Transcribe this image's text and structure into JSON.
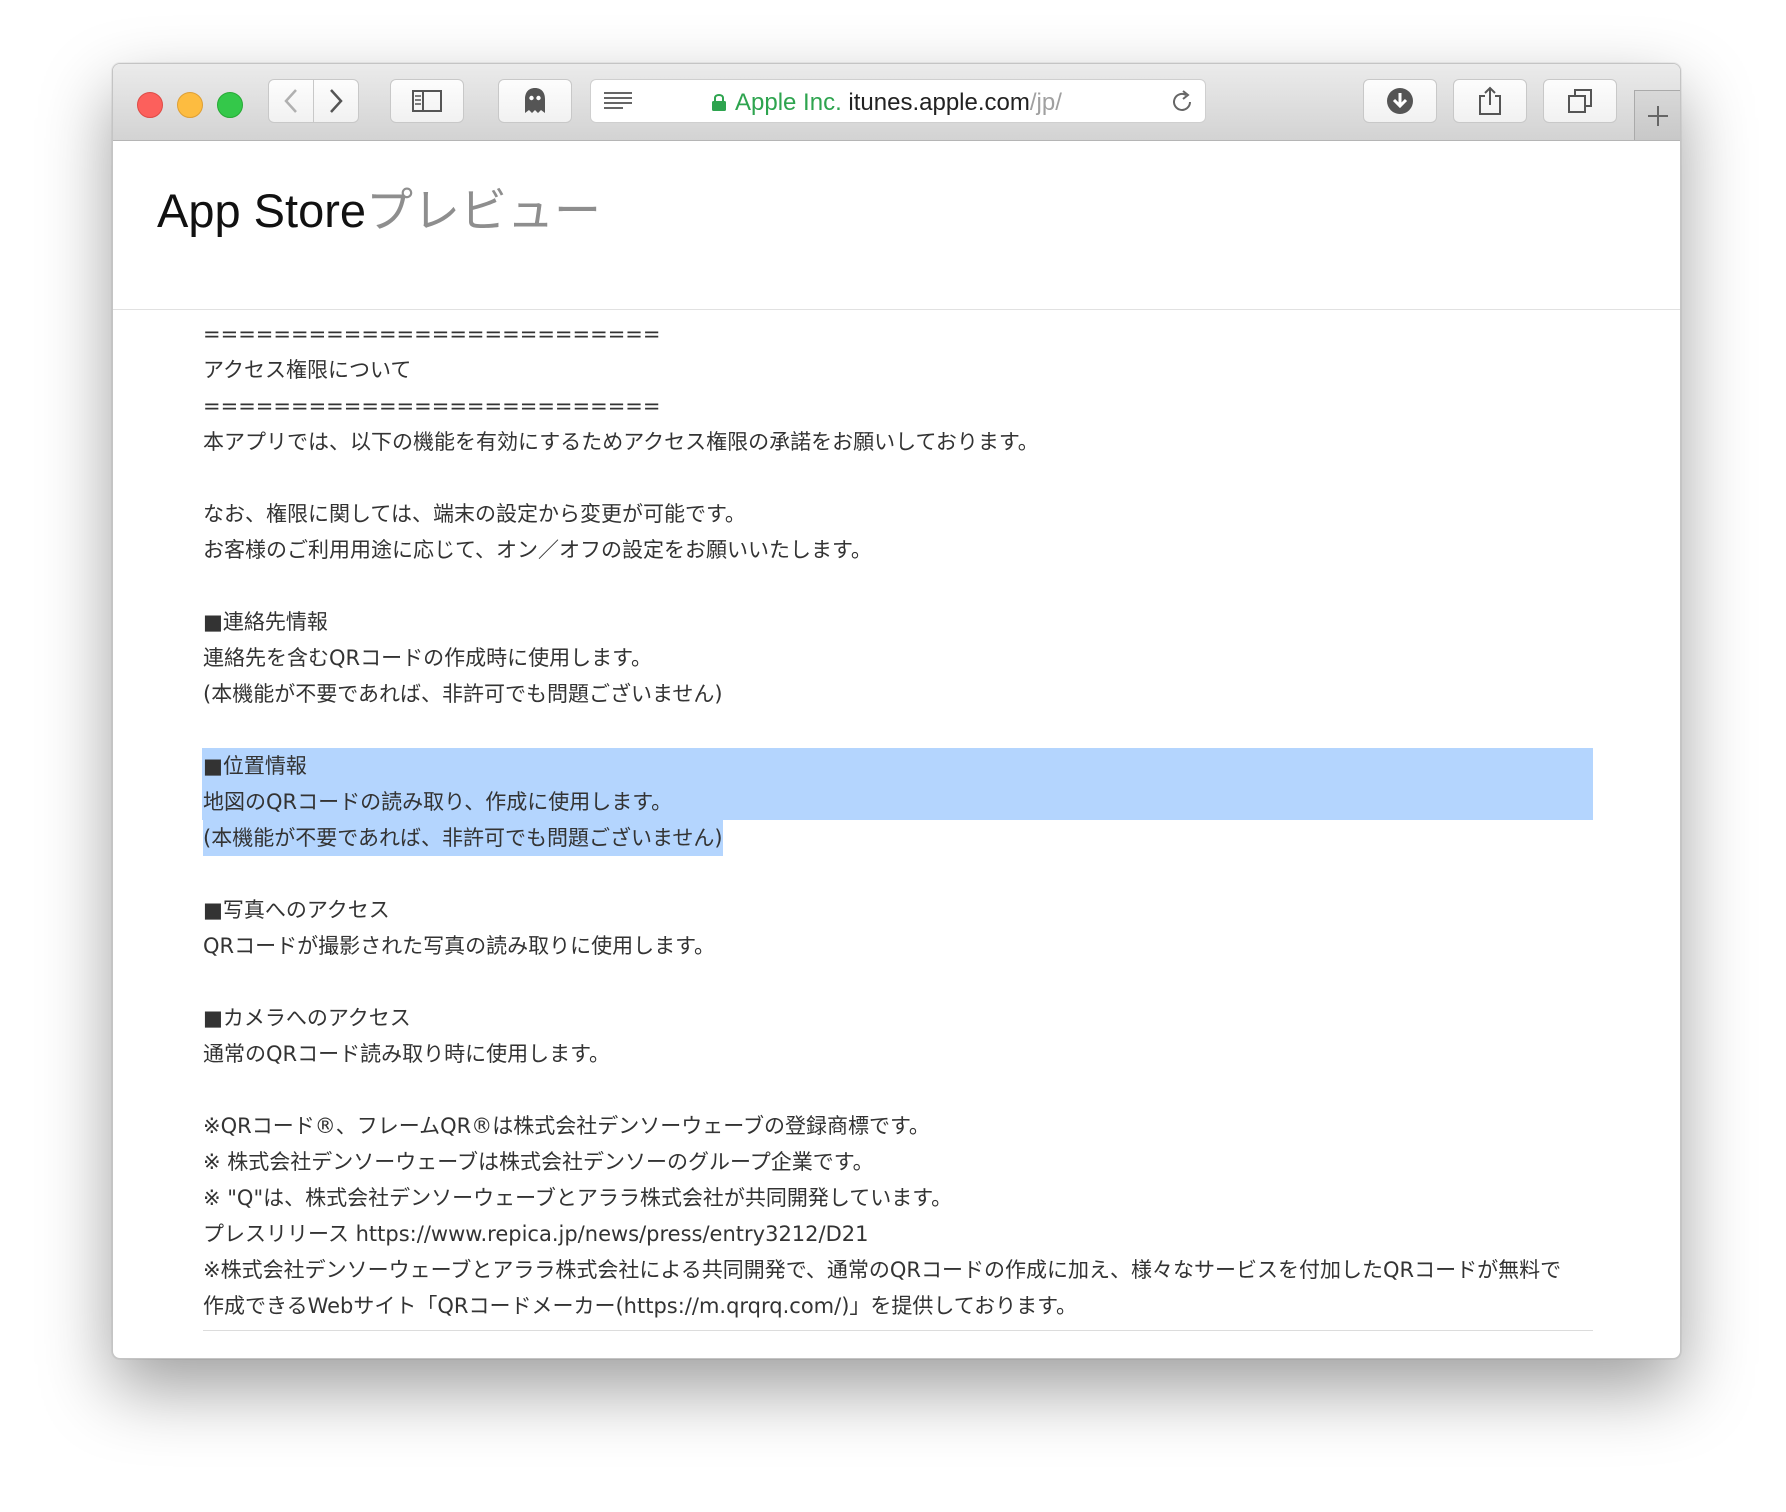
{
  "browser": {
    "address_bar": {
      "org": "Apple Inc.",
      "host": "itunes.apple.com",
      "path": "/jp/"
    },
    "icons": {
      "back": "chevron-left-icon",
      "forward": "chevron-right-icon",
      "sidebar": "sidebar-icon",
      "ghostery": "ghost-icon",
      "reader": "reader-icon",
      "lock": "lock-icon",
      "reload": "reload-icon",
      "download": "download-icon",
      "share": "share-icon",
      "tabs": "tabs-icon",
      "new_tab": "plus-icon"
    },
    "accent_colors": {
      "org": "#2ea44f",
      "selection": "#b4d5fe"
    }
  },
  "header": {
    "title": "App Store",
    "subtitle": "プレビュー"
  },
  "content": {
    "lines": [
      "==========================",
      "アクセス権限について",
      "==========================",
      "本アプリでは、以下の機能を有効にするためアクセス権限の承諾をお願いしております。",
      "",
      "なお、権限に関しては、端末の設定から変更が可能です。",
      "お客様のご利用用途に応じて、オン／オフの設定をお願いいたします。",
      "",
      "■連絡先情報",
      "連絡先を含むQRコードの作成時に使用します。",
      "(本機能が不要であれば、非許可でも問題ございません)",
      "",
      "■位置情報",
      "地図のQRコードの読み取り、作成に使用します。",
      "(本機能が不要であれば、非許可でも問題ございません)",
      "",
      "■写真へのアクセス",
      "QRコードが撮影された写真の読み取りに使用します。",
      "",
      "■カメラへのアクセス",
      "通常のQRコード読み取り時に使用します。",
      "",
      "※QRコード®、フレームQR®は株式会社デンソーウェーブの登録商標です。",
      "※ 株式会社デンソーウェーブは株式会社デンソーのグループ企業です。",
      "※ \"Q\"は、株式会社デンソーウェーブとアララ株式会社が共同開発しています。",
      "プレスリリース https://www.repica.jp/news/press/entry3212/D21",
      "※株式会社デンソーウェーブとアララ株式会社による共同開発で、通常のQRコードの作成に加え、様々なサービスを付加したQRコードが無料で",
      "作成できるWebサイト「QRコードメーカー(https://m.qrqrq.com/)」を提供しております。"
    ]
  }
}
